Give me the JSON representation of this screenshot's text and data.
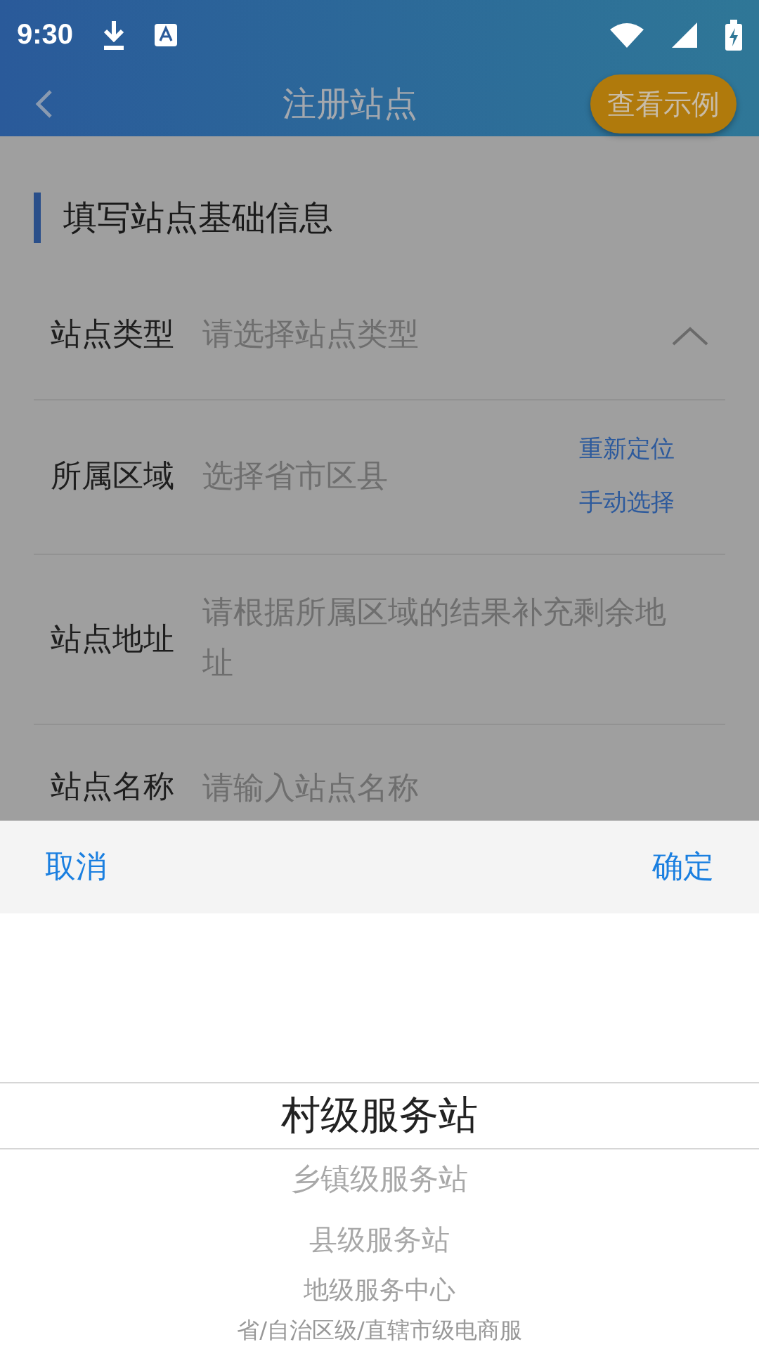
{
  "status_bar": {
    "time": "9:30"
  },
  "header": {
    "title": "注册站点",
    "action": "查看示例"
  },
  "section_title": "填写站点基础信息",
  "fields": [
    {
      "kind": "select",
      "label": "站点类型",
      "placeholder": "请选择站点类型",
      "expanded": true
    },
    {
      "kind": "region",
      "label": "所属区域",
      "placeholder": "选择省市区县",
      "actions": [
        "重新定位",
        "手动选择"
      ]
    },
    {
      "kind": "text",
      "label": "站点地址",
      "placeholder": "请根据所属区域的结果补充剩余地址"
    },
    {
      "kind": "text",
      "label": "站点名称",
      "placeholder": "请输入站点名称"
    }
  ],
  "picker": {
    "cancel": "取消",
    "confirm": "确定",
    "options": [
      {
        "label": "村级服务站",
        "selected": true
      },
      {
        "label": "乡镇级服务站",
        "selected": false
      },
      {
        "label": "县级服务站",
        "selected": false
      },
      {
        "label": "地级服务中心",
        "selected": false
      },
      {
        "label": "省/自治区级/直辖市级电商服",
        "selected": false
      }
    ]
  }
}
